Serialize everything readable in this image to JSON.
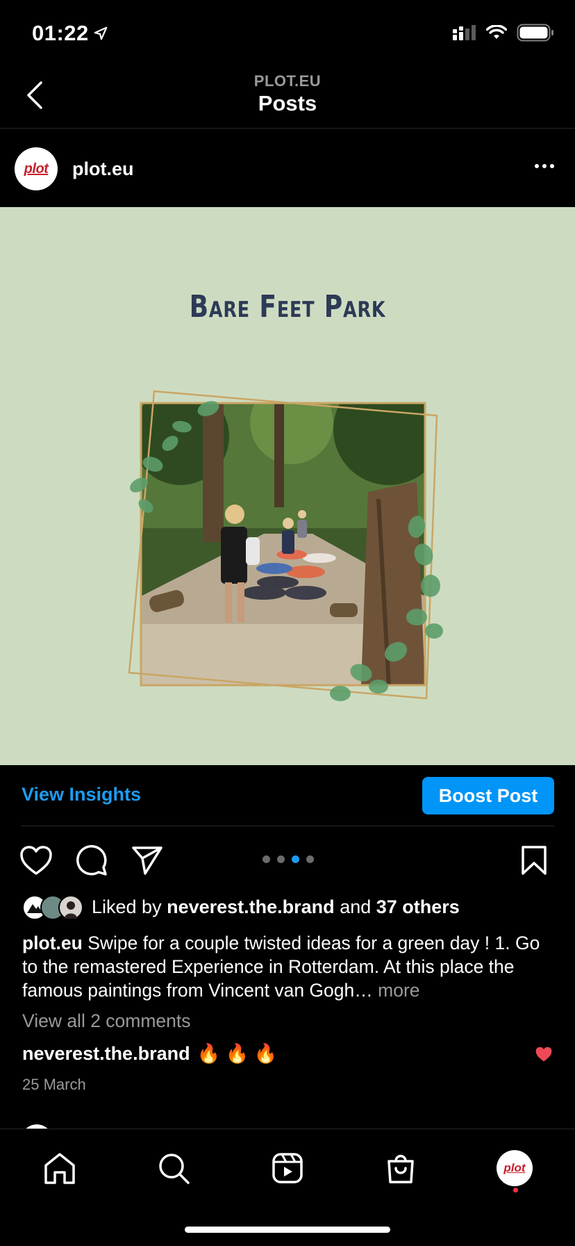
{
  "status_bar": {
    "time": "01:22"
  },
  "header": {
    "subtitle": "PLOT.EU",
    "title": "Posts"
  },
  "post": {
    "username": "plot.eu",
    "avatar_text": "plot",
    "image_title": "Bare Feet Park",
    "carousel": {
      "count": 4,
      "active_index": 2
    },
    "liked_by_prefix": "Liked by",
    "liked_by_user": "neverest.the.brand",
    "liked_by_and": "and",
    "liked_by_others": "37 others",
    "caption_user": "plot.eu",
    "caption_text": "Swipe for a couple twisted ideas for a green day ! 1. Go to the remastered Experience in Rotterdam. At this place the famous paintings from Vincent van Gogh…",
    "caption_more": "more",
    "view_comments": "View all 2 comments",
    "comment_user": "neverest.the.brand",
    "comment_text": "🔥 🔥 🔥",
    "date": "25 March"
  },
  "insights": {
    "view_label": "View Insights",
    "boost_label": "Boost Post"
  },
  "tabbar": {
    "items": [
      "home-icon",
      "search-icon",
      "reels-icon",
      "shop-icon",
      "profile-avatar"
    ],
    "profile_text": "plot"
  },
  "colors": {
    "accent": "#0095f6",
    "link": "#1e9bf0",
    "image_bg": "#cddcc1",
    "title_text": "#2d3a56",
    "heart_red": "#ed4956"
  }
}
